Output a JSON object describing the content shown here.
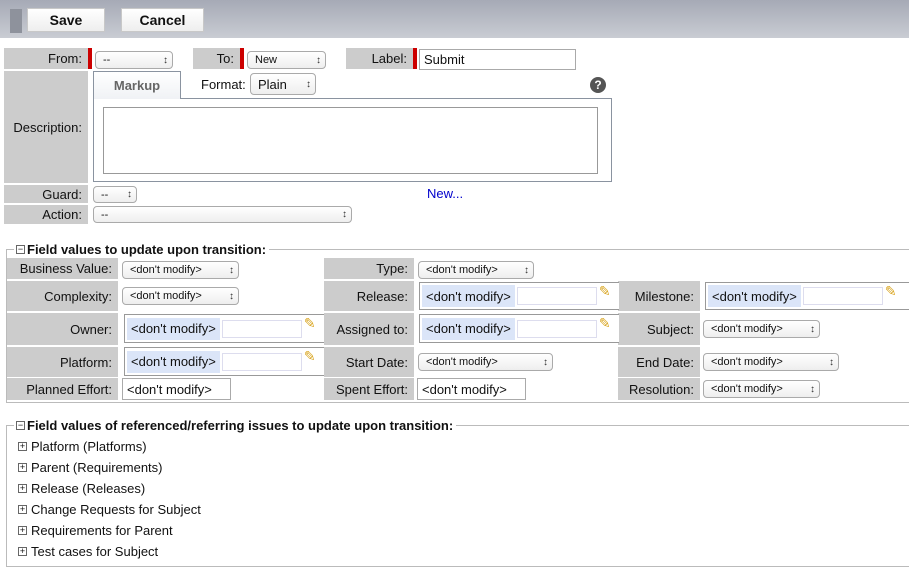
{
  "toolbar": {
    "save": "Save",
    "cancel": "Cancel"
  },
  "header": {
    "from_label": "From:",
    "from_value": "--",
    "to_label": "To:",
    "to_value": "New",
    "label_label": "Label:",
    "label_value": "Submit"
  },
  "description": {
    "label": "Description:",
    "tab": "Markup",
    "format_label": "Format:",
    "format_value": "Plain",
    "help": "?",
    "text": ""
  },
  "guard": {
    "label": "Guard:",
    "value": "--",
    "new_link": "New..."
  },
  "action": {
    "label": "Action:",
    "value": "--"
  },
  "fields": {
    "legend": "Field values to update upon transition:",
    "toggle": "−",
    "business_value": {
      "label": "Business Value:",
      "value": "<don't modify>"
    },
    "type": {
      "label": "Type:",
      "value": "<don't modify>"
    },
    "complexity": {
      "label": "Complexity:",
      "value": "<don't modify>"
    },
    "release": {
      "label": "Release:",
      "value": "<don't modify>"
    },
    "milestone": {
      "label": "Milestone:",
      "value": "<don't modify>"
    },
    "owner": {
      "label": "Owner:",
      "value": "<don't modify>"
    },
    "assigned_to": {
      "label": "Assigned to:",
      "value": "<don't modify>"
    },
    "subject": {
      "label": "Subject:",
      "value": "<don't modify>"
    },
    "platform": {
      "label": "Platform:",
      "value": "<don't modify>"
    },
    "start_date": {
      "label": "Start Date:",
      "value": "<don't modify>"
    },
    "end_date": {
      "label": "End Date:",
      "value": "<don't modify>"
    },
    "planned_effort": {
      "label": "Planned Effort:",
      "value": "<don't modify>"
    },
    "spent_effort": {
      "label": "Spent Effort:",
      "value": "<don't modify>"
    },
    "resolution": {
      "label": "Resolution:",
      "value": "<don't modify>"
    }
  },
  "referenced": {
    "legend": "Field values of referenced/referring issues to update upon transition:",
    "toggle": "−",
    "expand": "+",
    "items": [
      "Platform (Platforms)",
      "Parent (Requirements)",
      "Release (Releases)",
      "Change Requests for Subject",
      "Requirements for Parent",
      "Test cases for Subject"
    ]
  }
}
